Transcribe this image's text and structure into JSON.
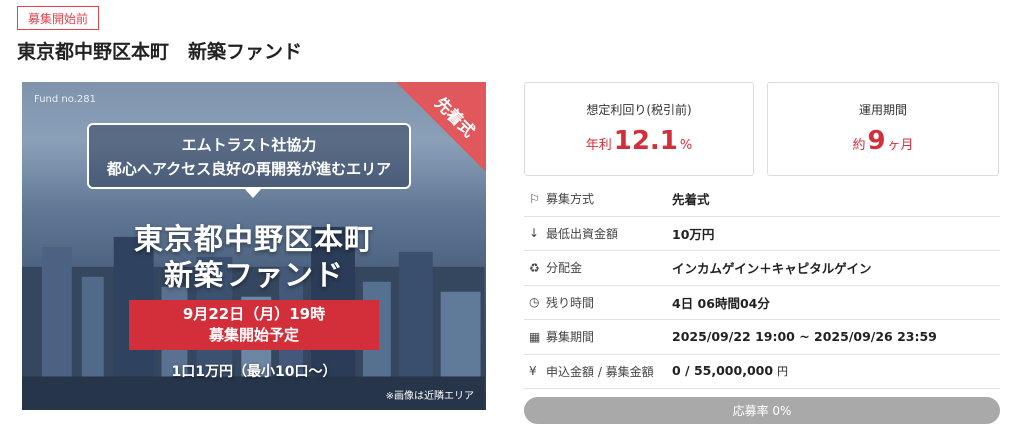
{
  "status_badge": "募集開始前",
  "page_title": "東京都中野区本町　新築ファンド",
  "hero": {
    "fund_no": "Fund no.281",
    "corner_label": "先着式",
    "bubble_line1": "エムトラスト社協力",
    "bubble_line2": "都心へアクセス良好の再開発が進むエリア",
    "headline_line1": "東京都中野区本町",
    "headline_line2": "新築ファンド",
    "date_line1": "9月22日（月）19時",
    "date_line2": "募集開始予定",
    "unit_text": "1口1万円（最小10口～）",
    "note": "※画像は近隣エリア"
  },
  "yield_card": {
    "label": "想定利回り(税引前)",
    "prefix": "年利",
    "value": "12.1",
    "suffix": "%"
  },
  "period_card": {
    "label": "運用期間",
    "prefix": "約",
    "value": "9",
    "suffix": "ヶ月"
  },
  "details": [
    {
      "icon": "flag-icon",
      "glyph": "⚐",
      "label": "募集方式",
      "value": "先着式"
    },
    {
      "icon": "arrow-down-icon",
      "glyph": "↓",
      "label": "最低出資金額",
      "value": "10万円"
    },
    {
      "icon": "piggy-bank-icon",
      "glyph": "♻",
      "label": "分配金",
      "value": "インカムゲイン＋キャピタルゲイン"
    },
    {
      "icon": "clock-icon",
      "glyph": "◷",
      "label": "残り時間",
      "value": "4日 06時間04分"
    },
    {
      "icon": "calendar-icon",
      "glyph": "▦",
      "label": "募集期間",
      "value": "2025/09/22 19:00 ~ 2025/09/26 23:59"
    },
    {
      "icon": "yen-icon",
      "glyph": "¥",
      "label": "申込金額 / 募集金額",
      "value": "0 / 55,000,000",
      "unit": "円"
    }
  ],
  "progress": {
    "label": "応募率 0%",
    "fraction": 0.0
  },
  "colors": {
    "accent": "#d32f3a",
    "badge": "#e0444b",
    "progress_bg": "#a9a9a9"
  }
}
